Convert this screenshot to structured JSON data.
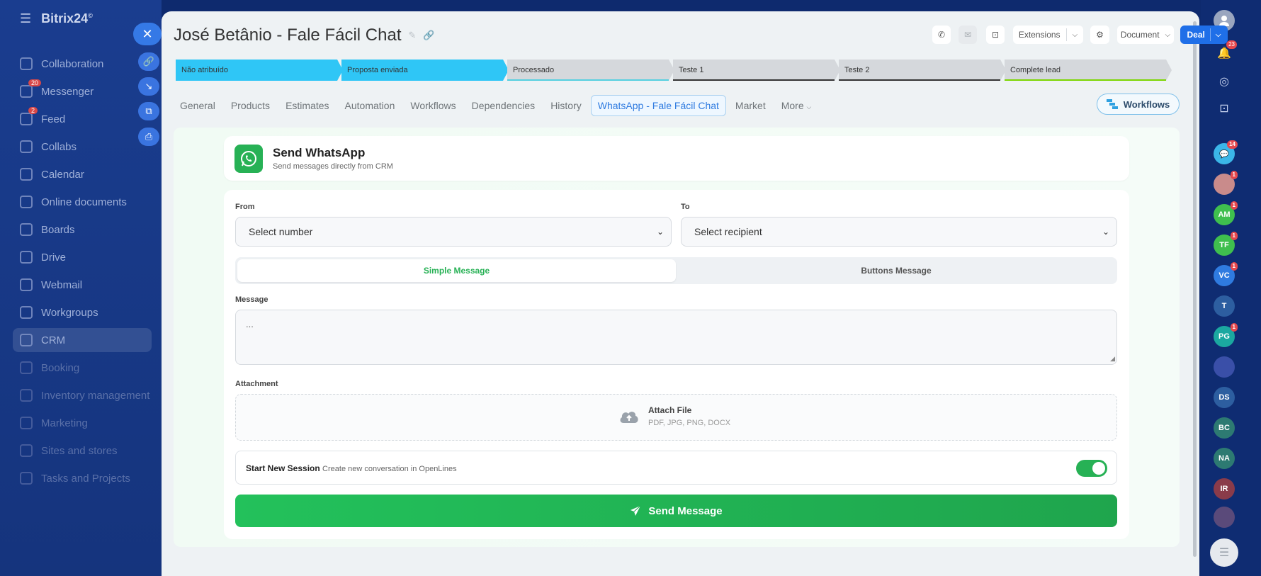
{
  "sidebar": {
    "logo": "Bitrix24",
    "logo_mark": "©",
    "items": [
      {
        "label": "Collaboration",
        "badge": ""
      },
      {
        "label": "Messenger",
        "badge": "20"
      },
      {
        "label": "Feed",
        "badge": "2"
      },
      {
        "label": "Collabs",
        "badge": ""
      },
      {
        "label": "Calendar",
        "badge": ""
      },
      {
        "label": "Online documents",
        "badge": ""
      },
      {
        "label": "Boards",
        "badge": ""
      },
      {
        "label": "Drive",
        "badge": ""
      },
      {
        "label": "Webmail",
        "badge": ""
      },
      {
        "label": "Workgroups",
        "badge": ""
      },
      {
        "label": "CRM",
        "badge": ""
      },
      {
        "label": "Booking",
        "badge": ""
      },
      {
        "label": "Inventory management",
        "badge": ""
      },
      {
        "label": "Marketing",
        "badge": ""
      },
      {
        "label": "Sites and stores",
        "badge": ""
      },
      {
        "label": "Tasks and Projects",
        "badge": ""
      }
    ]
  },
  "header": {
    "title": "José Betânio - Fale Fácil Chat",
    "extensions_label": "Extensions",
    "document_label": "Document",
    "deal_label": "Deal"
  },
  "stages": [
    {
      "label": "Não atribuído",
      "color": "#2fc6f6",
      "line": "#2fc6f6"
    },
    {
      "label": "Proposta enviada",
      "color": "#2fc6f6",
      "line": "#2fc6f6"
    },
    {
      "label": "Processado",
      "color": "#d5d8dc",
      "line": "#55d0e0"
    },
    {
      "label": "Teste 1",
      "color": "#d5d8dc",
      "line": "#333333"
    },
    {
      "label": "Teste 2",
      "color": "#d5d8dc",
      "line": "#333333"
    },
    {
      "label": "Complete lead",
      "color": "#d5d8dc",
      "line": "#7bd500"
    }
  ],
  "tabs": [
    {
      "label": "General"
    },
    {
      "label": "Products"
    },
    {
      "label": "Estimates"
    },
    {
      "label": "Automation"
    },
    {
      "label": "Workflows"
    },
    {
      "label": "Dependencies"
    },
    {
      "label": "History"
    },
    {
      "label": "WhatsApp - Fale Fácil Chat"
    },
    {
      "label": "Market"
    },
    {
      "label": "More"
    }
  ],
  "workflows_button": "Workflows",
  "whatsapp": {
    "title": "Send WhatsApp",
    "subtitle": "Send messages directly from CRM",
    "from_label": "From",
    "from_value": "Select number",
    "to_label": "To",
    "to_value": "Select recipient",
    "mode_simple": "Simple Message",
    "mode_buttons": "Buttons Message",
    "message_label": "Message",
    "message_placeholder": "...",
    "attachment_label": "Attachment",
    "attach_title": "Attach File",
    "attach_types": "PDF, JPG, PNG, DOCX",
    "session_title": "Start New Session",
    "session_desc": "Create new conversation in OpenLines",
    "session_enabled": true,
    "send_label": "Send Message"
  },
  "rail": {
    "notifications_badge": "23",
    "chat_badge": "14",
    "avatars": [
      {
        "initials": "",
        "color": "#c98b8b",
        "badge": "1"
      },
      {
        "initials": "AM",
        "color": "#3fbf4e",
        "badge": "1"
      },
      {
        "initials": "TF",
        "color": "#3fbf4e",
        "badge": "1"
      },
      {
        "initials": "VC",
        "color": "#2f7be0",
        "badge": "1"
      },
      {
        "initials": "T",
        "color": "#2d5ea0",
        "badge": ""
      },
      {
        "initials": "PG",
        "color": "#1ba8a0",
        "badge": "1"
      },
      {
        "initials": "",
        "color": "#3a4fa8",
        "badge": ""
      },
      {
        "initials": "DS",
        "color": "#2d5ea0",
        "badge": ""
      },
      {
        "initials": "BC",
        "color": "#2d7a72",
        "badge": ""
      },
      {
        "initials": "NA",
        "color": "#2d7a72",
        "badge": ""
      },
      {
        "initials": "IR",
        "color": "#8a3b4a",
        "badge": ""
      },
      {
        "initials": "",
        "color": "#5a4a7a",
        "badge": ""
      }
    ]
  }
}
